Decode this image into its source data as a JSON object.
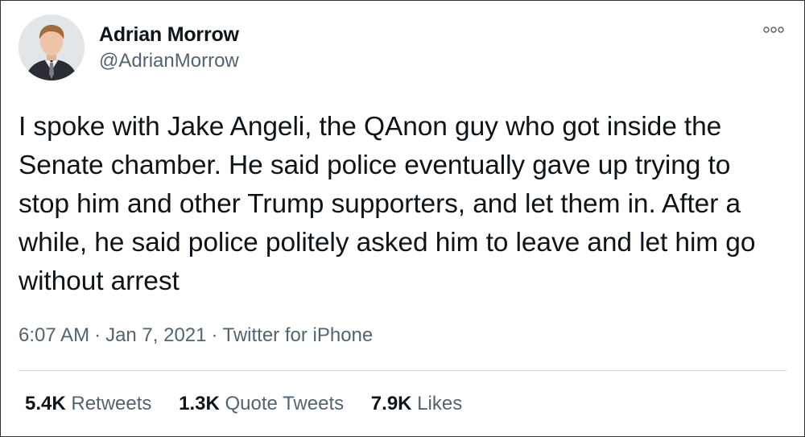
{
  "tweet": {
    "author": {
      "name": "Adrian Morrow",
      "handle": "@AdrianMorrow"
    },
    "text": "I spoke with Jake Angeli, the QAnon guy who got inside the Senate chamber. He said police eventually gave up trying to stop him and other Trump supporters, and let them in. After a while, he said police politely asked him to leave and let him go without arrest",
    "time": "6:07 AM",
    "separator": "·",
    "date": "Jan 7, 2021",
    "source": "Twitter for iPhone",
    "stats": [
      {
        "count": "5.4K",
        "label": "Retweets"
      },
      {
        "count": "1.3K",
        "label": "Quote Tweets"
      },
      {
        "count": "7.9K",
        "label": "Likes"
      }
    ]
  },
  "icons": {
    "more": "more-options-icon"
  },
  "colors": {
    "text": "#0f1419",
    "secondary": "#536471",
    "divider": "#cfd9de"
  }
}
